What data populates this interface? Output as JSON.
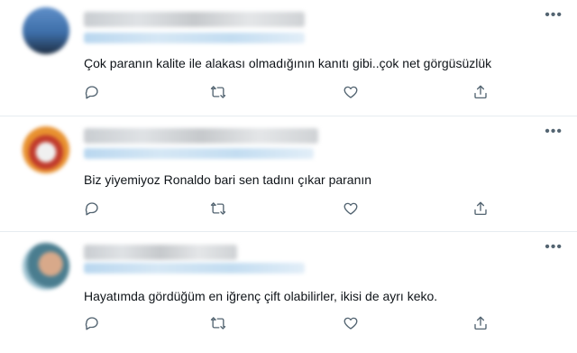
{
  "tweets": [
    {
      "text": "Çok paranın kalite ile alakası olmadığının kanıtı gibi..çok net görgüsüzlük",
      "more": "•••"
    },
    {
      "text": "Biz yiyemiyoz Ronaldo bari sen tadını çıkar paranın",
      "more": "•••"
    },
    {
      "text": "Hayatımda gördüğüm en iğrenç çift olabilirler, ikisi de ayrı keko.",
      "more": "•••"
    }
  ],
  "icons": {
    "reply": "reply-icon",
    "retweet": "retweet-icon",
    "like": "like-icon",
    "share": "share-icon",
    "more": "more-icon"
  },
  "colors": {
    "icon": "#536471",
    "divider": "#e6ecf0",
    "handle_blue": "#1d9bf0"
  }
}
